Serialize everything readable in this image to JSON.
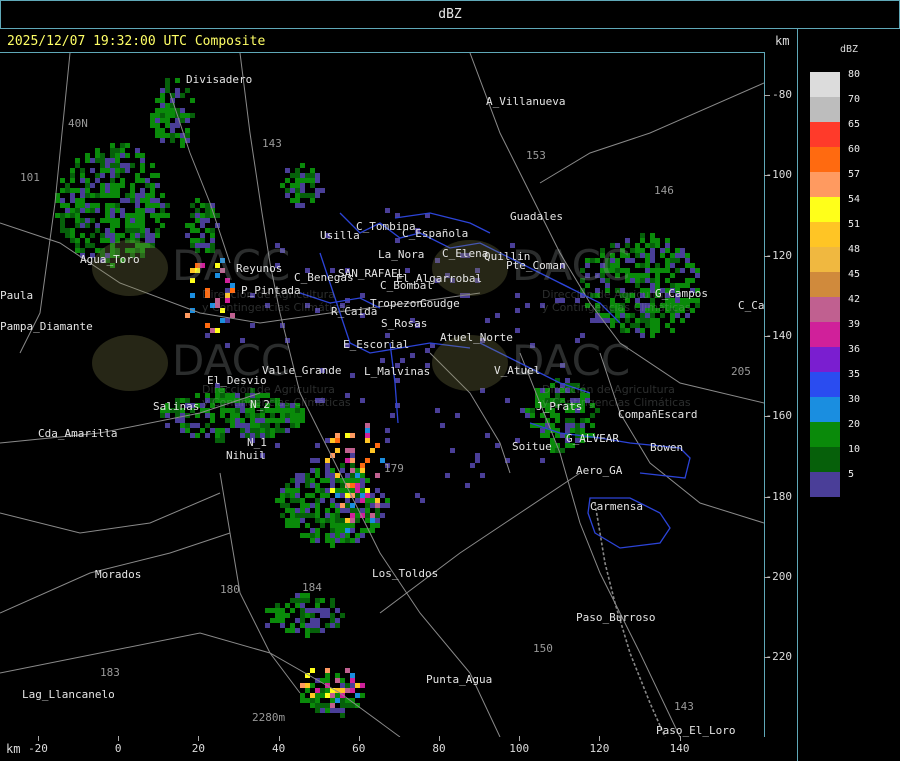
{
  "header": {
    "title": "dBZ"
  },
  "timestamp": "2025/12/07 19:32:00 UTC Composite",
  "units": {
    "top_right": "km",
    "bottom_left": "km"
  },
  "legend": {
    "title": "dBZ",
    "items": [
      {
        "label": "80",
        "color": "#dcdcdc"
      },
      {
        "label": "70",
        "color": "#bdbdbd"
      },
      {
        "label": "65",
        "color": "#ff3a2a"
      },
      {
        "label": "60",
        "color": "#ff6a10"
      },
      {
        "label": "57",
        "color": "#ff9a60"
      },
      {
        "label": "54",
        "color": "#ffff1a"
      },
      {
        "label": "51",
        "color": "#ffc525"
      },
      {
        "label": "48",
        "color": "#f0b840"
      },
      {
        "label": "45",
        "color": "#d08a3c"
      },
      {
        "label": "42",
        "color": "#c06090"
      },
      {
        "label": "39",
        "color": "#d0209a"
      },
      {
        "label": "36",
        "color": "#7a1ed0"
      },
      {
        "label": "35",
        "color": "#2a4cf0"
      },
      {
        "label": "30",
        "color": "#1a8ee0"
      },
      {
        "label": "20",
        "color": "#0a8a0a"
      },
      {
        "label": "10",
        "color": "#06600a"
      },
      {
        "label": "5",
        "color": "#4a3e98"
      }
    ]
  },
  "y_axis_ticks": [
    "-80",
    "-100",
    "-120",
    "-140",
    "-160",
    "-180",
    "-200",
    "-220"
  ],
  "x_axis_ticks": [
    "-20",
    "0",
    "20",
    "40",
    "60",
    "80",
    "100",
    "120",
    "140"
  ],
  "places": [
    {
      "name": "Divisadero"
    },
    {
      "name": "A_Villanueva"
    },
    {
      "name": "40N"
    },
    {
      "name": "101"
    },
    {
      "name": "143"
    },
    {
      "name": "153"
    },
    {
      "name": "146"
    },
    {
      "name": "Guadales"
    },
    {
      "name": "C_Tombina"
    },
    {
      "name": "Usilla"
    },
    {
      "name": "C_Española"
    },
    {
      "name": "La_Nora"
    },
    {
      "name": "C_Elena"
    },
    {
      "name": "Quillin"
    },
    {
      "name": "Pte_Coman"
    },
    {
      "name": "Agua_Toro"
    },
    {
      "name": "Reyunos"
    },
    {
      "name": "SAN_RAFAEL"
    },
    {
      "name": "El_Algarrobal"
    },
    {
      "name": "Pampa_Diamante"
    },
    {
      "name": "C_Benegas"
    },
    {
      "name": "Paula"
    },
    {
      "name": "C_Bombal"
    },
    {
      "name": "P_Pintada"
    },
    {
      "name": "Tropezon"
    },
    {
      "name": "Goudge"
    },
    {
      "name": "R_Caida"
    },
    {
      "name": "S_Rosas"
    },
    {
      "name": "Atuel_Norte"
    },
    {
      "name": "E_Escorial"
    },
    {
      "name": "El_Desvio"
    },
    {
      "name": "Valle_Grande"
    },
    {
      "name": "L_Malvinas"
    },
    {
      "name": "V_Atuel"
    },
    {
      "name": "Salinas"
    },
    {
      "name": "N_2"
    },
    {
      "name": "Cda_Amarilla"
    },
    {
      "name": "N_1"
    },
    {
      "name": "Nihuil"
    },
    {
      "name": "Soitue"
    },
    {
      "name": "J_Prats"
    },
    {
      "name": "CompañEscard"
    },
    {
      "name": "G_ALVEAR"
    },
    {
      "name": "Bowen"
    },
    {
      "name": "Aero_GA"
    },
    {
      "name": "Carmensa"
    },
    {
      "name": "Morados"
    },
    {
      "name": "Los_Toldos"
    },
    {
      "name": "Paso_Burroso"
    },
    {
      "name": "Punta_Agua"
    },
    {
      "name": "Lag_Llancanelo"
    },
    {
      "name": "Paso_El_Loro"
    },
    {
      "name": "C_Campos"
    },
    {
      "name": "G_Campos"
    },
    {
      "name": "205"
    },
    {
      "name": "184"
    },
    {
      "name": "180"
    },
    {
      "name": "179"
    },
    {
      "name": "150"
    },
    {
      "name": "183"
    },
    {
      "name": "143"
    },
    {
      "name": "2280m"
    }
  ],
  "watermark": {
    "brand": "DACC",
    "line1": "Dirección de Agricultura",
    "line2": "y Contingencias Climáticas"
  }
}
